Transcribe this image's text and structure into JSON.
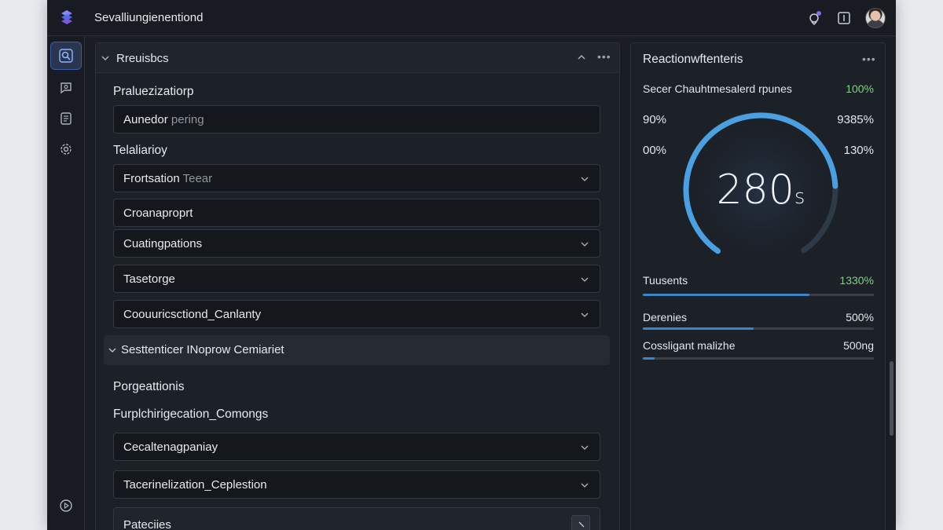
{
  "app": {
    "title": "Sevalliungienentiond"
  },
  "sidebar": {
    "items": [
      {
        "icon": "search-icon",
        "active": true
      },
      {
        "icon": "chat-search-icon",
        "active": false
      },
      {
        "icon": "document-icon",
        "active": false
      },
      {
        "icon": "gear-icon",
        "active": false
      }
    ],
    "bottom_icon": "play-circle-icon"
  },
  "left_panel": {
    "title": "Rreuisbcs",
    "sections": [
      {
        "label": "Praluezizatiorp"
      },
      {
        "label": "Telaliarioy"
      },
      {
        "label": "Porgeattionis"
      },
      {
        "label": "Furplchirigecation_Comongs"
      }
    ],
    "fields": [
      {
        "value": "Aunedor",
        "placeholder": "pering"
      },
      {
        "value": "Frortsation",
        "placeholder": "Teear"
      },
      {
        "value": "Croanaproprt"
      },
      {
        "value": "Cuatingpations"
      },
      {
        "value": "Tasetorge"
      },
      {
        "value": "Coouuricsctiond_Canlanty"
      },
      {
        "value": "Cecaltenagpaniay"
      },
      {
        "value": "Tacerinelization_Ceplestion"
      },
      {
        "value": "Pateciies"
      }
    ],
    "subsection": {
      "label": "Sesttenticer INoprow Cemiariet"
    }
  },
  "right_panel": {
    "title": "Reactionwftenteris",
    "top_row": {
      "label": "Secer Chauhtmesalerd rpunes",
      "value": "100%"
    },
    "gauge_labels": {
      "left_top": "90%",
      "right_top": "9385%",
      "left_mid": "00%",
      "right_mid": "130%"
    },
    "gauge": {
      "value": "280",
      "unit": "s",
      "fraction": 0.8
    },
    "metrics": [
      {
        "label": "Tuusents",
        "value": "1330%",
        "fraction": 0.72,
        "value_green": true
      },
      {
        "label": "Derenies",
        "value": "500%",
        "fraction": 0.48,
        "value_green": false
      },
      {
        "label": "Cossligant malizhe",
        "value": "500ng",
        "fraction": 0.05,
        "value_green": false
      }
    ]
  },
  "colors": {
    "accent": "#3a86c8",
    "green": "#7bd47f",
    "background": "#1a1d24"
  }
}
